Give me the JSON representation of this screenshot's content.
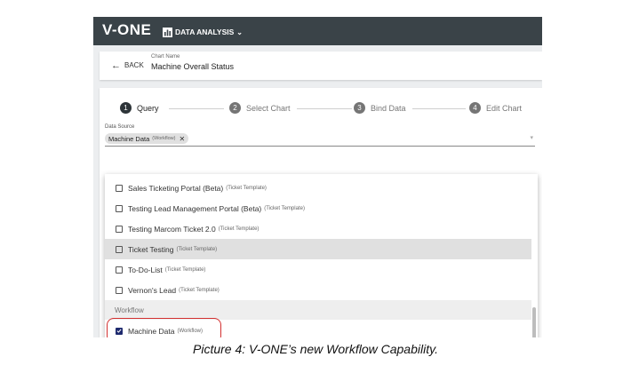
{
  "app": {
    "logo": "V-ONE",
    "nav_menu": "DATA ANALYSIS",
    "nav_icon": "bar-chart-icon"
  },
  "header": {
    "back_label": "BACK",
    "chart_name_label": "Chart Name",
    "chart_name_value": "Machine Overall Status"
  },
  "steps": [
    {
      "num": "1",
      "label": "Query",
      "active": true
    },
    {
      "num": "2",
      "label": "Select Chart",
      "active": false
    },
    {
      "num": "3",
      "label": "Bind Data",
      "active": false
    },
    {
      "num": "4",
      "label": "Edit Chart",
      "active": false
    }
  ],
  "data_source": {
    "label": "Data Source",
    "chip_name": "Machine Data",
    "chip_type": "(Workflow)",
    "chip_remove": "✕"
  },
  "dropdown": {
    "items": [
      {
        "name": "Sales Ticketing Portal (Beta)",
        "type": "(Ticket Template)",
        "checked": false
      },
      {
        "name": "Testing Lead Management Portal (Beta)",
        "type": "(Ticket Template)",
        "checked": false
      },
      {
        "name": "Testing Marcom Ticket 2.0",
        "type": "(Ticket Template)",
        "checked": false
      },
      {
        "name": "Ticket Testing",
        "type": "(Ticket Template)",
        "checked": false
      },
      {
        "name": "To-Do-List",
        "type": "(Ticket Template)",
        "checked": false
      },
      {
        "name": "Vernon's Lead",
        "type": "(Ticket Template)",
        "checked": false
      }
    ],
    "group_header": "Workflow",
    "workflow_item": {
      "name": "Machine Data",
      "type": "(Workflow)",
      "checked": true
    }
  },
  "caption": "Picture 4: V-ONE’s new Workflow Capability.",
  "colors": {
    "topbar": "#3a4348",
    "checkbox_checked": "#1e2a6e",
    "highlight_ring": "#d32f2f"
  }
}
